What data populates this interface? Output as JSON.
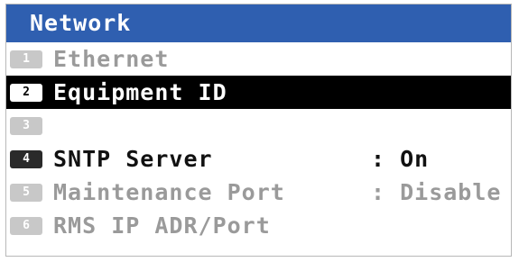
{
  "window": {
    "title": "Network"
  },
  "menu": {
    "items": [
      {
        "number": "1",
        "label": "Ethernet",
        "value": ""
      },
      {
        "number": "2",
        "label": "Equipment ID",
        "value": ""
      },
      {
        "number": "3",
        "label": "",
        "value": ""
      },
      {
        "number": "4",
        "label": "SNTP Server",
        "value": ": On"
      },
      {
        "number": "5",
        "label": "Maintenance Port",
        "value": ": Disable"
      },
      {
        "number": "6",
        "label": "RMS IP ADR/Port",
        "value": ""
      }
    ]
  },
  "colors": {
    "title_bar": "#2f5fb0",
    "selected_row": "#000000",
    "active_text": "#111111",
    "disabled_text": "#9a9a9a"
  }
}
